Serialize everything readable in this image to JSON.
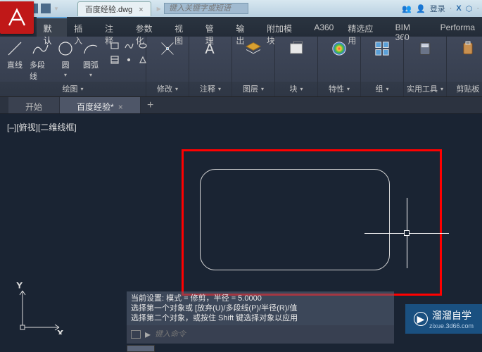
{
  "titlebar": {
    "filename": "百度经验.dwg",
    "search_placeholder": "键入关键字或短语",
    "login": "登录"
  },
  "menu": {
    "tabs": [
      "默认",
      "插入",
      "注释",
      "参数化",
      "视图",
      "管理",
      "输出",
      "附加模块",
      "A360",
      "精选应用",
      "BIM 360",
      "Performa"
    ],
    "active": 0
  },
  "ribbon": {
    "draw": {
      "line": "直线",
      "polyline": "多段线",
      "circle": "圆",
      "arc": "圆弧",
      "label": "绘图"
    },
    "modify": {
      "label": "修改"
    },
    "annotate": {
      "label": "注释"
    },
    "layers": {
      "label": "图层"
    },
    "block": {
      "label": "块"
    },
    "properties": {
      "label": "特性"
    },
    "groups": {
      "label": "组"
    },
    "utilities": {
      "label": "实用工具"
    },
    "clipboard": {
      "label": "剪贴板"
    }
  },
  "drawtabs": {
    "start": "开始",
    "current": "百度经验*"
  },
  "viewport_label": "[–][俯视][二维线框]",
  "command": {
    "line1": "当前设置: 模式 = 修剪，半径 = 5.0000",
    "line2": "选择第一个对象或 [放弃(U)/多段线(P)/半径(R)/值",
    "line3": "选择第二个对象，或按住 Shift 键选择对象以应用",
    "prompt": "键入命令"
  },
  "ucs": {
    "x": "X",
    "y": "Y"
  },
  "watermark": {
    "text": "溜溜自学",
    "sub": "zixue.3d66.com"
  }
}
